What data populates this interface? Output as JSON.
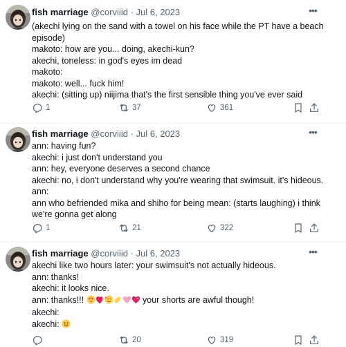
{
  "tweets": [
    {
      "name": "fish marriage",
      "handle": "@corviiid",
      "separator": "·",
      "date": "Jul 6, 2023",
      "lines": [
        "(akechi lying on the sand with a towel on his face while the PT have a beach",
        "episode)",
        "makoto: how are you... doing, akechi-kun?",
        "akechi, toneless: in god's eyes im dead",
        "makoto:",
        "makoto: well... fuck him!",
        "akechi: (sitting up) niijima that's the first sensible thing you've ever said"
      ],
      "replies": "1",
      "retweets": "37",
      "likes": "361"
    },
    {
      "name": "fish marriage",
      "handle": "@corviiid",
      "separator": "·",
      "date": "Jul 6, 2023",
      "lines": [
        "ann: having fun?",
        "akechi: i just don't understand you",
        "ann: hey, everyone deserves a second chance",
        "akechi: no, i don't understand why you're wearing that swimsuit. it's hideous.",
        "ann:",
        "ann who befriended mika and shiho for being mean: (starts laughing) i think",
        "we're gonna get along"
      ],
      "replies": "1",
      "retweets": "21",
      "likes": "322"
    },
    {
      "name": "fish marriage",
      "handle": "@corviiid",
      "separator": "·",
      "date": "Jul 6, 2023",
      "lines": [
        "akechi like two hours later: your swimsuit's not actually hideous.",
        "ann: thanks!",
        "akechi: it looks nice.",
        "ann: thanks!!!",
        "akechi:",
        "akechi:"
      ],
      "line4_suffix": " your shorts are awful though!",
      "line4_emojis": [
        "heart-eyes-emoji",
        "two-hearts-emoji",
        "smiling-hearts-emoji",
        "clapping-hand-emoji",
        "pink-heart-emoji",
        "sparkling-heart-emoji"
      ],
      "line6_emoji": "smiling-face-emoji",
      "replies": "",
      "retweets": "20",
      "likes": "319"
    }
  ],
  "colors": {
    "text": "#0f1419",
    "muted": "#536471",
    "divider": "#eff3f4",
    "heart_red": "#e0245e",
    "heart_pink": "#f4a6c6",
    "emoji_yellow": "#ffcc4d"
  },
  "icons": [
    "more-icon",
    "reply-icon",
    "retweet-icon",
    "like-icon",
    "bookmark-icon",
    "share-icon"
  ]
}
